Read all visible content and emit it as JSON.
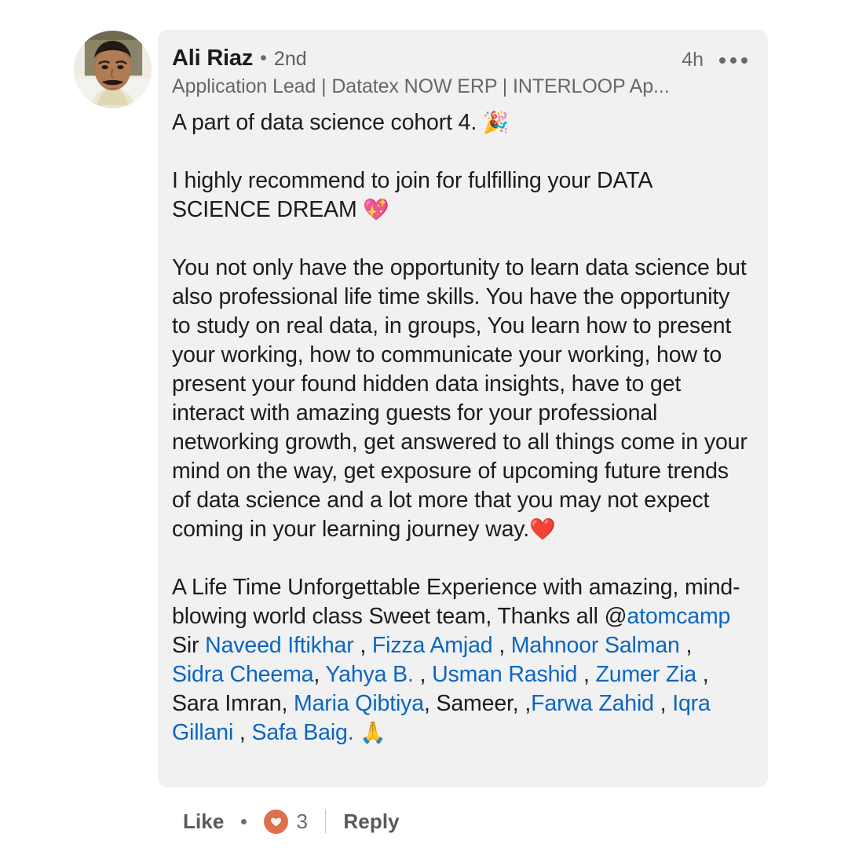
{
  "comment": {
    "author": {
      "name": "Ali Riaz",
      "separator": "•",
      "degree": "2nd",
      "headline": "Application Lead | Datatex NOW ERP | INTERLOOP Ap...",
      "avatar_alt": "profile-photo"
    },
    "timestamp": "4h",
    "more_menu": "more-options",
    "body": {
      "para1": "A part of data science cohort 4. ",
      "para1_emoji": "🎉",
      "para2_line1": "I highly recommend to join for fulfilling your DATA",
      "para2_line2": "SCIENCE DREAM ",
      "para2_emoji": "💖",
      "para3": "You not only have the opportunity to learn data science but also professional life time skills. You have the opportunity to study on real data, in groups, You learn how to present your working, how to communicate your working, how to present your found hidden data insights, have to get interact with amazing guests for your professional networking growth, get answered to all things come in your mind on the way, get exposure of upcoming future trends of data science and a lot more that you may not expect coming in your learning journey way.",
      "para3_emoji": "❤️",
      "para4_intro": "A Life Time Unforgettable Experience with amazing, mind-blowing world class Sweet team, Thanks all @",
      "para4_emoji": "🙏",
      "mentions": [
        {
          "text": "atomcamp",
          "link": true
        },
        {
          "text": " Sir ",
          "link": false
        },
        {
          "text": "Naveed Iftikhar",
          "link": true
        },
        {
          "text": " , ",
          "link": false
        },
        {
          "text": "Fizza Amjad",
          "link": true
        },
        {
          "text": " , ",
          "link": false
        },
        {
          "text": "Mahnoor Salman",
          "link": true
        },
        {
          "text": " , ",
          "link": false
        },
        {
          "text": "Sidra Cheema",
          "link": true
        },
        {
          "text": ",  ",
          "link": false
        },
        {
          "text": "Yahya B.",
          "link": true
        },
        {
          "text": " , ",
          "link": false
        },
        {
          "text": "Usman Rashid",
          "link": true
        },
        {
          "text": " , ",
          "link": false
        },
        {
          "text": "Zumer Zia",
          "link": true
        },
        {
          "text": " , Sara Imran, ",
          "link": false
        },
        {
          "text": "Maria Qibtiya",
          "link": true
        },
        {
          "text": ", Sameer, ,",
          "link": false
        },
        {
          "text": "Farwa Zahid",
          "link": true
        },
        {
          "text": " ,  ",
          "link": false
        },
        {
          "text": "Iqra Gillani",
          "link": true
        },
        {
          "text": " , ",
          "link": false
        },
        {
          "text": "Safa Baig.",
          "link": true
        },
        {
          "text": " ",
          "link": false
        }
      ]
    }
  },
  "actions": {
    "like_label": "Like",
    "reaction_icon": "heart-reaction-icon",
    "reaction_count": "3",
    "reply_label": "Reply"
  },
  "colors": {
    "card_background": "#f1f1f1",
    "page_background": "#ffffff",
    "link_blue": "#0a66c2",
    "text_primary": "#1c1c1c",
    "text_secondary": "#6a6a6a",
    "reaction_orange": "#df704d"
  }
}
